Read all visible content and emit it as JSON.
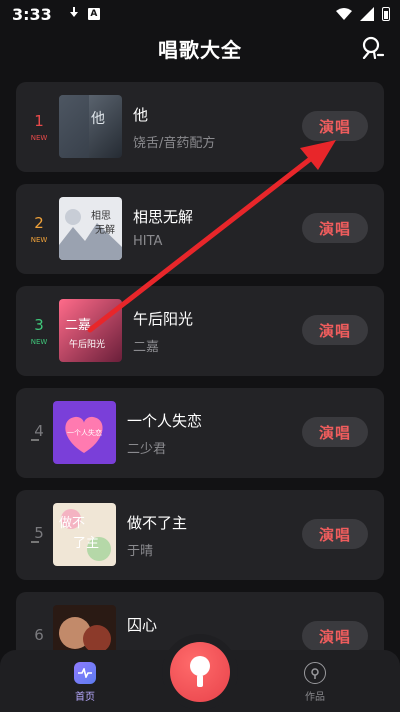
{
  "status_bar": {
    "time": "3:33",
    "icons": [
      "download-icon",
      "a-app-icon",
      "wifi-icon",
      "signal-icon",
      "battery-icon"
    ]
  },
  "header": {
    "title": "唱歌大全",
    "profile_icon": "profile-icon"
  },
  "songs": [
    {
      "rank": "1",
      "badge": "NEW",
      "title": "他",
      "artist": "饶舌/音药配方",
      "action": "演唱",
      "rank_color": "#e84a4a",
      "cover_text": "他"
    },
    {
      "rank": "2",
      "badge": "NEW",
      "title": "相思无解",
      "artist": "HITA",
      "action": "演唱",
      "rank_color": "#f0a23a",
      "cover_text": "相思无解"
    },
    {
      "rank": "3",
      "badge": "NEW",
      "title": "午后阳光",
      "artist": "二嘉",
      "action": "演唱",
      "rank_color": "#3fc77a",
      "cover_text": "二嘉"
    },
    {
      "rank": "4",
      "badge": "",
      "title": "一个人失恋",
      "artist": "二少君",
      "action": "演唱",
      "rank_color": "#7a7a7e",
      "cover_text": "一个人失恋"
    },
    {
      "rank": "5",
      "badge": "",
      "title": "做不了主",
      "artist": "于晴",
      "action": "演唱",
      "rank_color": "#7a7a7e",
      "cover_text": "做不了主"
    },
    {
      "rank": "6",
      "badge": "",
      "title": "囚心",
      "artist": "",
      "action": "演唱",
      "rank_color": "#7a7a7e",
      "cover_text": ""
    }
  ],
  "bottom_nav": {
    "home_label": "首页",
    "works_label": "作品",
    "active": "home"
  },
  "colors": {
    "accent_red": "#f05d5d",
    "background": "#121214",
    "card": "#232326"
  }
}
